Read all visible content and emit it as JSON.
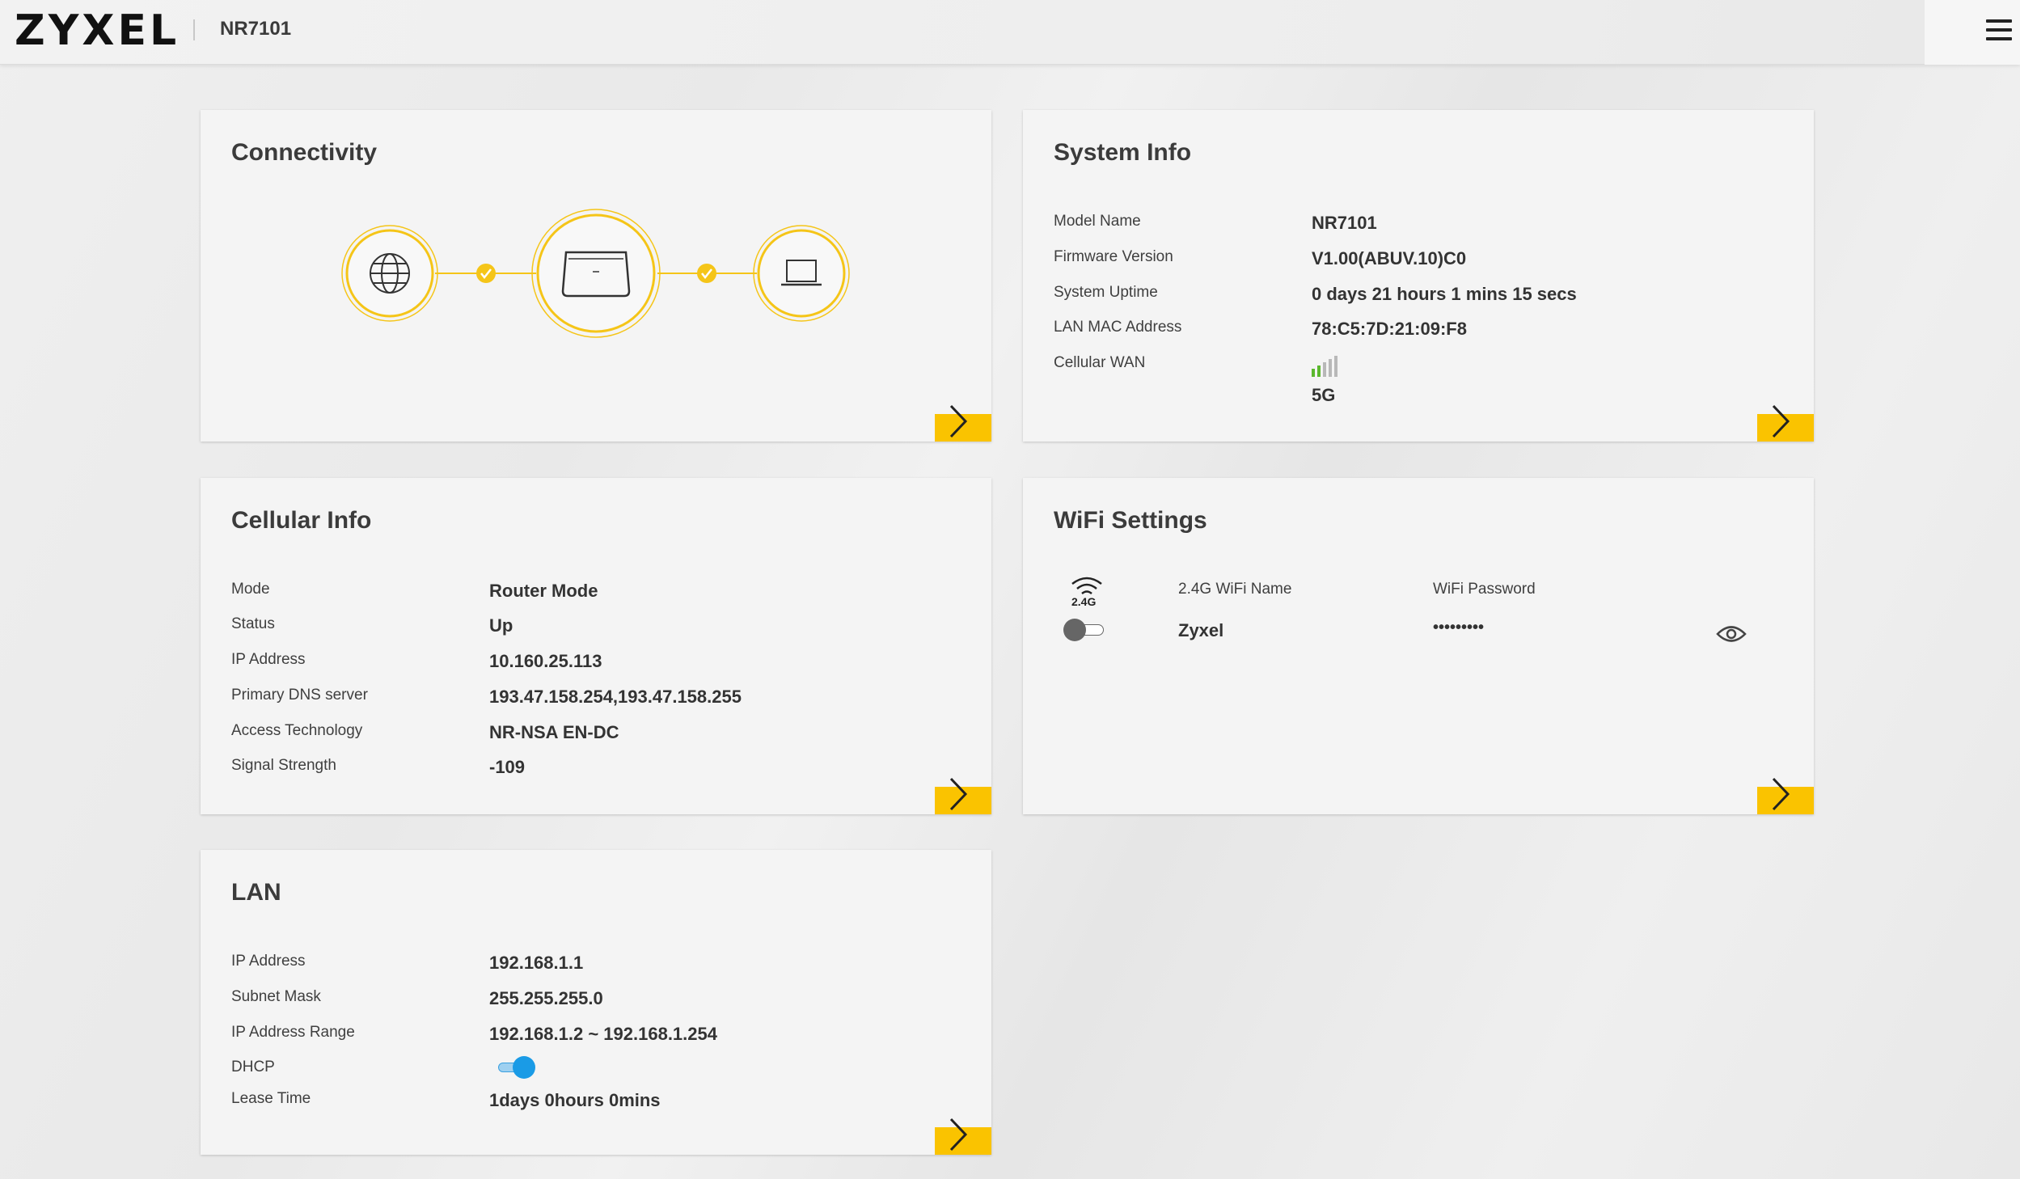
{
  "header": {
    "logo": "ZYXEL",
    "model": "NR7101"
  },
  "colors": {
    "accent": "#fac300",
    "ring": "#f5c518",
    "toggle_on": "#1a9be6",
    "signal_green": "#5cb82e"
  },
  "connectivity": {
    "title": "Connectivity",
    "icons": [
      "globe-icon",
      "router-icon",
      "laptop-icon"
    ]
  },
  "system_info": {
    "title": "System Info",
    "rows": [
      {
        "label": "Model Name",
        "value": "NR7101"
      },
      {
        "label": "Firmware Version",
        "value": "V1.00(ABUV.10)C0"
      },
      {
        "label": "System Uptime",
        "value": "0 days 21 hours 1 mins 15 secs"
      },
      {
        "label": "LAN MAC Address",
        "value": "78:C5:7D:21:09:F8"
      },
      {
        "label": "Cellular WAN",
        "value": "5G"
      }
    ],
    "signal_bars_active": 2,
    "signal_bars_total": 5
  },
  "cellular_info": {
    "title": "Cellular Info",
    "rows": [
      {
        "label": "Mode",
        "value": "Router Mode"
      },
      {
        "label": "Status",
        "value": "Up"
      },
      {
        "label": "IP Address",
        "value": "10.160.25.113"
      },
      {
        "label": "Primary DNS server",
        "value": "193.47.158.254,193.47.158.255"
      },
      {
        "label": "Access Technology",
        "value": "NR-NSA EN-DC"
      },
      {
        "label": "Signal Strength",
        "value": "-109"
      }
    ]
  },
  "wifi": {
    "title": "WiFi Settings",
    "band_label": "2.4G",
    "name_header": "2.4G WiFi Name",
    "password_header": "WiFi Password",
    "name_value": "Zyxel",
    "password_value": "•••••••••",
    "enabled": false
  },
  "lan": {
    "title": "LAN",
    "rows": [
      {
        "label": "IP Address",
        "value": "192.168.1.1"
      },
      {
        "label": "Subnet Mask",
        "value": "255.255.255.0"
      },
      {
        "label": "IP Address Range",
        "value": "192.168.1.2 ~ 192.168.1.254"
      },
      {
        "label": "DHCP",
        "value": ""
      },
      {
        "label": "Lease Time",
        "value": "1days 0hours 0mins"
      }
    ],
    "dhcp_enabled": true
  }
}
